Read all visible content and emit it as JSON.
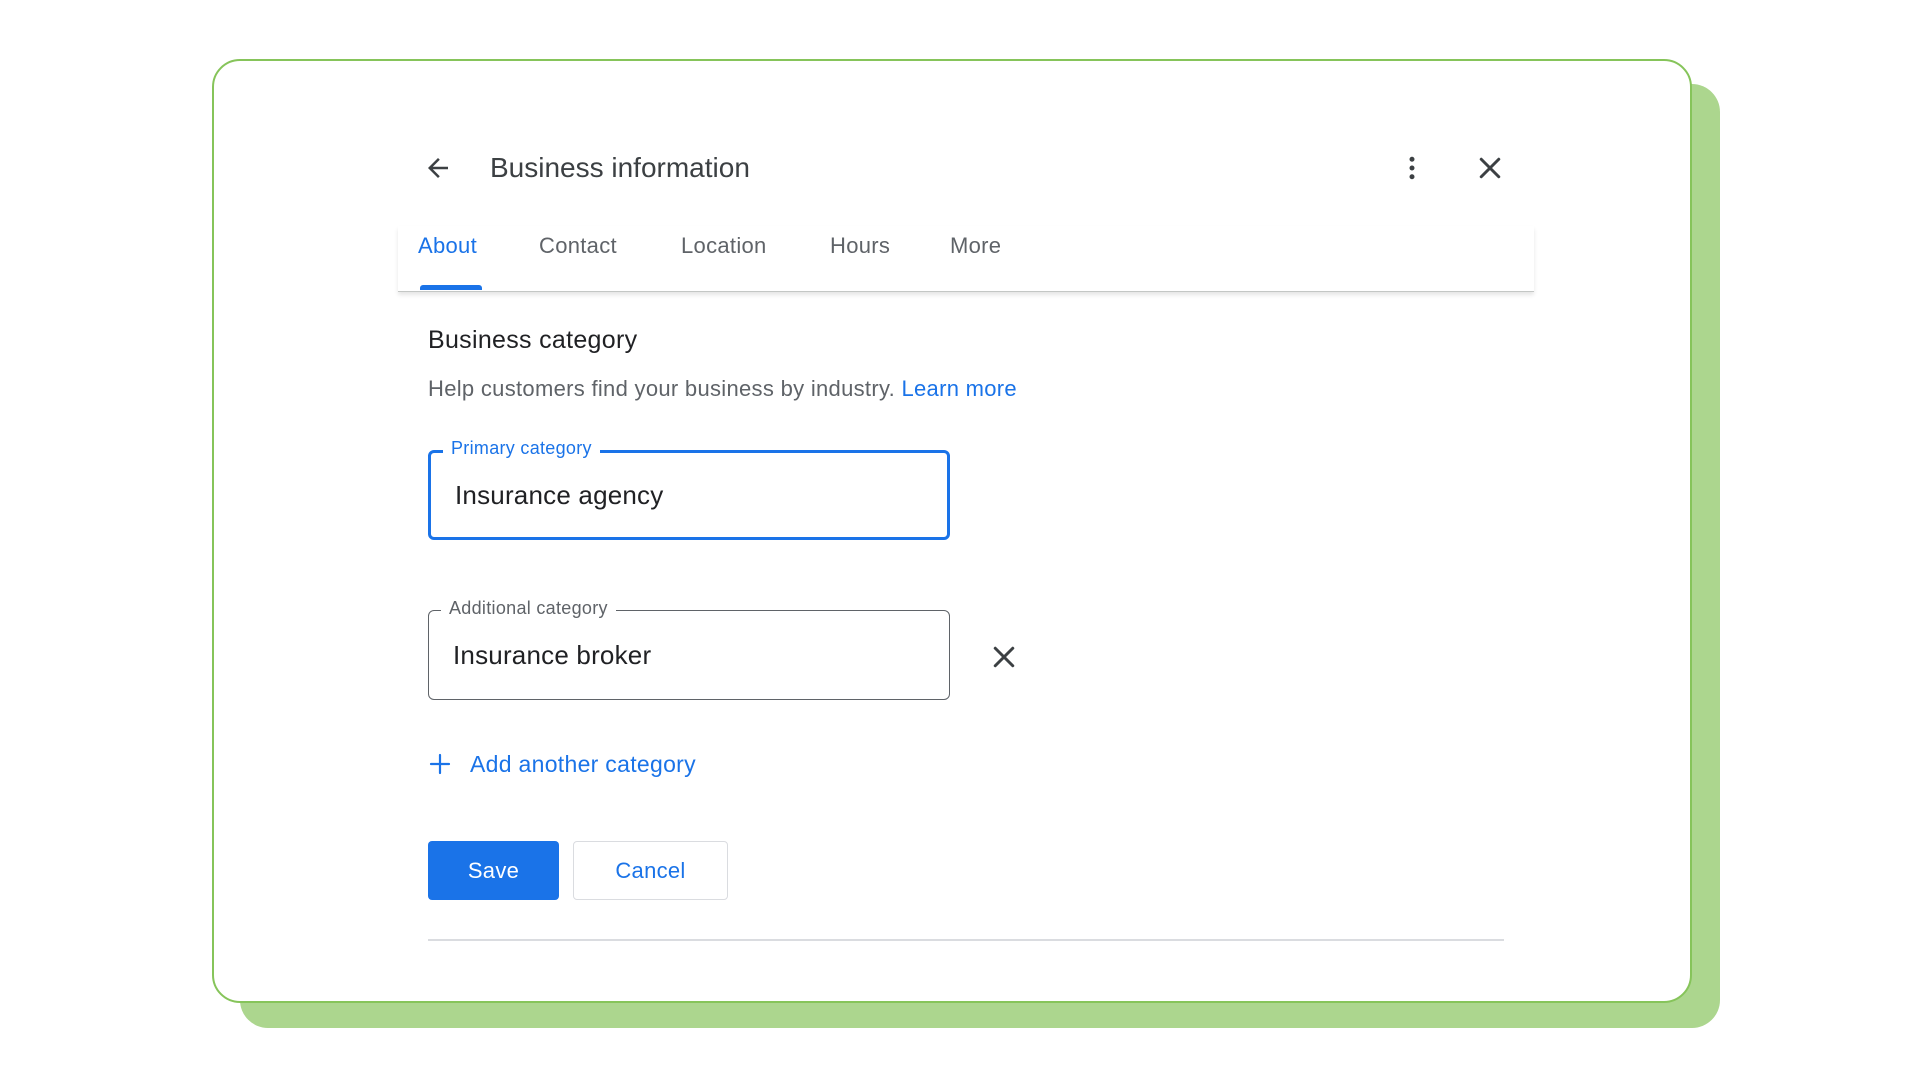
{
  "dialog": {
    "title": "Business information",
    "icons": {
      "back": "arrow-back-icon",
      "menu": "more-vert-icon",
      "close": "close-icon"
    }
  },
  "tabs": [
    {
      "label": "About",
      "active": true
    },
    {
      "label": "Contact",
      "active": false
    },
    {
      "label": "Location",
      "active": false
    },
    {
      "label": "Hours",
      "active": false
    },
    {
      "label": "More",
      "active": false
    }
  ],
  "section": {
    "title": "Business category",
    "help_text": "Help customers find your business by industry.",
    "learn_more": "Learn more"
  },
  "fields": {
    "primary": {
      "label": "Primary category",
      "value": "Insurance agency"
    },
    "additional": {
      "label": "Additional category",
      "value": "Insurance broker"
    }
  },
  "actions": {
    "add_category": "Add another category",
    "save": "Save",
    "cancel": "Cancel"
  },
  "colors": {
    "accent": "#1a73e8",
    "card_border": "#86c45a",
    "card_shadow": "#acd68e",
    "text_primary": "#202124",
    "text_secondary": "#5f6368"
  }
}
